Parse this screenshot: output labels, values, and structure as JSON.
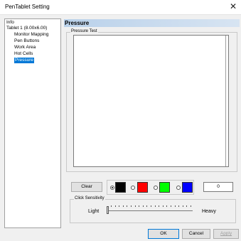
{
  "window": {
    "title": "PenTablet Setting",
    "close_glyph": "✕"
  },
  "tree": {
    "items": [
      {
        "label": "Info",
        "level": 0,
        "selected": false
      },
      {
        "label": "Tablet  1 (8.00x6.00)",
        "level": 0,
        "selected": false
      },
      {
        "label": "Monitor Mapping",
        "level": 1,
        "selected": false
      },
      {
        "label": "Pen Buttons",
        "level": 1,
        "selected": false
      },
      {
        "label": "Work Area",
        "level": 1,
        "selected": false
      },
      {
        "label": "Hot Cells",
        "level": 1,
        "selected": false
      },
      {
        "label": "Pressure",
        "level": 1,
        "selected": true
      }
    ]
  },
  "panel": {
    "header": "Pressure",
    "group_label": "Pressure Test",
    "clear_label": "Clear",
    "colors": [
      {
        "name": "black",
        "hex": "#000000",
        "selected": true
      },
      {
        "name": "red",
        "hex": "#ff0000",
        "selected": false
      },
      {
        "name": "green",
        "hex": "#00ff00",
        "selected": false
      },
      {
        "name": "blue",
        "hex": "#0000ff",
        "selected": false
      }
    ],
    "count": "0",
    "sensitivity": {
      "label": "Click Sensitivity",
      "min_label": "Light",
      "max_label": "Heavy",
      "value": 0
    }
  },
  "footer": {
    "ok": "OK",
    "cancel": "Cancel",
    "apply": "Apply"
  },
  "accent": "#0078d7"
}
